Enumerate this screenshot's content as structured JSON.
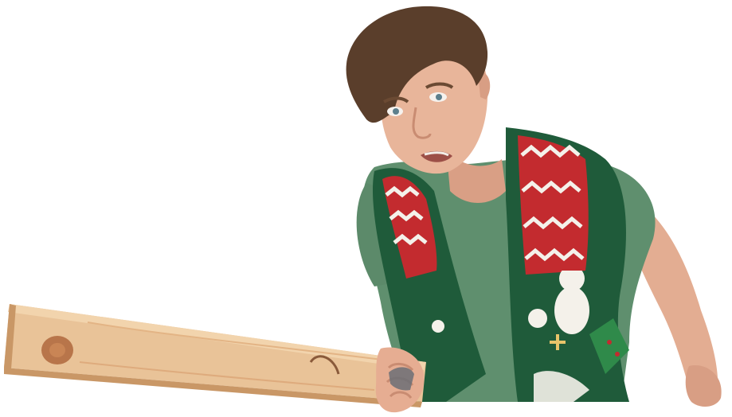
{
  "image": {
    "subject": "person-with-wooden-plank",
    "background": "#ffffff"
  },
  "colors": {
    "skin": "#e8b59a",
    "skin_shadow": "#c98c72",
    "hair": "#5a3e2b",
    "tshirt": "#5f8f6e",
    "vest_green": "#1f5b3a",
    "vest_red": "#c32b2f",
    "vest_white": "#f4f1ea",
    "wood": "#e9c398",
    "wood_edge": "#c99766",
    "knot": "#b8754a"
  }
}
